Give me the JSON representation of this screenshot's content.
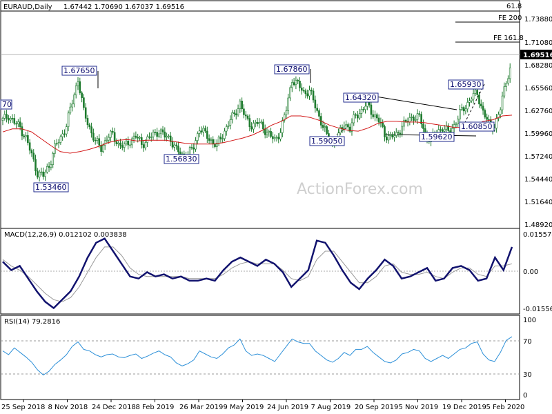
{
  "header": {
    "symbol": "EURAUD,Daily",
    "ohlc": "1.67442 1.70690 1.67037 1.69516"
  },
  "watermark": "ActionForex.com",
  "chart_data": [
    {
      "type": "candlestick",
      "y_ticks": [
        "1.73880",
        "1.71080",
        "1.68280",
        "1.65560",
        "1.62760",
        "1.59960",
        "1.57240",
        "1.54440",
        "1.51640",
        "1.48920"
      ],
      "ylim": [
        1.48,
        1.765
      ],
      "current_price": "1.69516",
      "fib_levels": [
        {
          "label": "61.8",
          "value": 1.765
        },
        {
          "label": "FE 200",
          "value": 1.741
        },
        {
          "label": "FE 161.8",
          "value": 1.7125
        }
      ],
      "annotations": [
        {
          "label": "1.67650",
          "value": 1.6765
        },
        {
          "label": "1.53460",
          "value": 1.5346
        },
        {
          "label": "1.56830",
          "value": 1.5683
        },
        {
          "label": "1.67860",
          "value": 1.6786
        },
        {
          "label": "1.59050",
          "value": 1.5905
        },
        {
          "label": "1.64320",
          "value": 1.6432
        },
        {
          "label": "1.59620",
          "value": 1.5962
        },
        {
          "label": "1.65930",
          "value": 1.6593
        },
        {
          "label": "1.60850",
          "value": 1.6085
        },
        {
          "label": "70",
          "value": 1.638
        }
      ],
      "close_path": [
        1.621,
        1.628,
        1.618,
        1.612,
        1.598,
        1.575,
        1.552,
        1.548,
        1.562,
        1.585,
        1.598,
        1.615,
        1.645,
        1.676,
        1.632,
        1.612,
        1.593,
        1.585,
        1.598,
        1.602,
        1.59,
        1.586,
        1.595,
        1.6,
        1.59,
        1.596,
        1.602,
        1.608,
        1.6,
        1.597,
        1.582,
        1.575,
        1.576,
        1.586,
        1.612,
        1.602,
        1.595,
        1.588,
        1.602,
        1.618,
        1.628,
        1.645,
        1.622,
        1.615,
        1.618,
        1.612,
        1.603,
        1.594,
        1.608,
        1.635,
        1.676,
        1.668,
        1.658,
        1.66,
        1.64,
        1.62,
        1.6,
        1.59,
        1.6,
        1.618,
        1.61,
        1.628,
        1.634,
        1.643,
        1.63,
        1.62,
        1.603,
        1.599,
        1.601,
        1.615,
        1.62,
        1.627,
        1.625,
        1.603,
        1.596,
        1.606,
        1.612,
        1.605,
        1.615,
        1.63,
        1.64,
        1.652,
        1.656,
        1.633,
        1.616,
        1.614,
        1.636,
        1.675,
        1.695
      ],
      "moving_average": [
        1.606,
        1.61,
        1.61,
        1.606,
        1.597,
        1.588,
        1.58,
        1.578,
        1.58,
        1.583,
        1.587,
        1.592,
        1.595,
        1.596,
        1.594,
        1.595,
        1.595,
        1.595,
        1.593,
        1.591,
        1.59,
        1.59,
        1.59,
        1.592,
        1.595,
        1.598,
        1.602,
        1.608,
        1.615,
        1.62,
        1.627,
        1.627,
        1.625,
        1.621,
        1.615,
        1.611,
        1.608,
        1.607,
        1.611,
        1.617,
        1.62,
        1.62,
        1.619,
        1.619,
        1.618,
        1.616,
        1.614,
        1.612,
        1.612,
        1.614,
        1.62,
        1.622,
        1.627,
        1.628
      ],
      "x_labels": [
        "25 Sep 2018",
        "8 Nov 2018",
        "24 Dec 2018",
        "8 Feb 2019",
        "26 Mar 2019",
        "9 May 2019",
        "24 Jun 2019",
        "7 Aug 2019",
        "20 Sep 2019",
        "5 Nov 2019",
        "19 Dec 2019",
        "5 Feb 2020"
      ]
    },
    {
      "type": "line",
      "title": "MACD(12,26,9) 0.012102 0.003838",
      "y_ticks": [
        "0.015574",
        "0.00",
        "-0.01556"
      ],
      "ylim": [
        -0.0175,
        0.0172
      ],
      "macd": [
        0.005,
        0.001,
        0.003,
        -0.003,
        -0.009,
        -0.014,
        -0.017,
        -0.013,
        -0.009,
        -0.002,
        0.007,
        0.014,
        0.016,
        0.01,
        0.004,
        -0.002,
        -0.003,
        0.0,
        -0.002,
        -0.001,
        -0.003,
        -0.002,
        -0.004,
        -0.004,
        -0.003,
        -0.004,
        0.001,
        0.005,
        0.007,
        0.005,
        0.003,
        0.006,
        0.004,
        0.0,
        -0.007,
        -0.003,
        0.001,
        0.015,
        0.014,
        0.008,
        0.001,
        -0.005,
        -0.008,
        -0.003,
        0.001,
        0.006,
        0.003,
        -0.003,
        -0.002,
        0.0,
        0.002,
        -0.004,
        -0.003,
        0.002,
        0.003,
        0.001,
        -0.004,
        -0.003,
        0.007,
        0.001,
        0.012
      ],
      "signal": [
        0.006,
        0.003,
        0.001,
        -0.002,
        -0.006,
        -0.01,
        -0.013,
        -0.014,
        -0.012,
        -0.007,
        0.0,
        0.007,
        0.012,
        0.012,
        0.008,
        0.002,
        -0.001,
        -0.002,
        -0.002,
        -0.002,
        -0.002,
        -0.002,
        -0.003,
        -0.003,
        -0.003,
        -0.003,
        -0.001,
        0.002,
        0.004,
        0.005,
        0.004,
        0.004,
        0.004,
        0.001,
        -0.003,
        -0.004,
        -0.002,
        0.006,
        0.01,
        0.01,
        0.005,
        0.0,
        -0.005,
        -0.005,
        -0.002,
        0.003,
        0.004,
        0.0,
        -0.001,
        -0.001,
        0.0,
        -0.002,
        -0.003,
        0.0,
        0.002,
        0.002,
        -0.001,
        -0.002,
        0.003,
        0.003,
        0.004
      ]
    },
    {
      "type": "line",
      "title": "RSI(14) 79.2816",
      "y_ticks": [
        "100",
        "70",
        "30",
        "0"
      ],
      "ylim": [
        0,
        100
      ],
      "guides": [
        70,
        30
      ],
      "values": [
        60,
        55,
        64,
        58,
        52,
        45,
        35,
        28,
        33,
        42,
        48,
        55,
        66,
        72,
        62,
        60,
        55,
        52,
        55,
        56,
        52,
        51,
        54,
        56,
        50,
        53,
        57,
        60,
        55,
        52,
        44,
        40,
        43,
        48,
        60,
        56,
        52,
        50,
        56,
        64,
        68,
        76,
        60,
        54,
        56,
        54,
        50,
        46,
        56,
        66,
        76,
        72,
        70,
        70,
        60,
        54,
        48,
        45,
        50,
        58,
        54,
        62,
        62,
        66,
        58,
        52,
        46,
        44,
        48,
        56,
        58,
        62,
        60,
        50,
        46,
        50,
        54,
        50,
        56,
        62,
        64,
        70,
        72,
        56,
        48,
        46,
        58,
        74,
        79
      ]
    }
  ]
}
